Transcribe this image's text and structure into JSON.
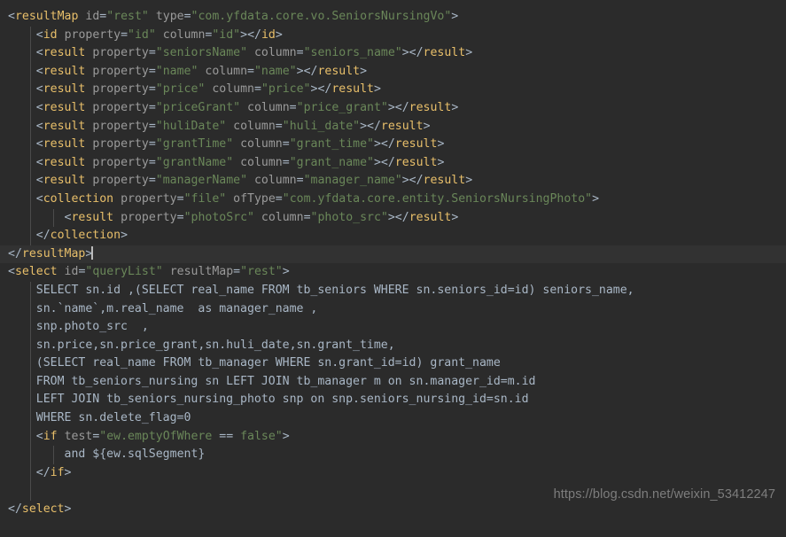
{
  "editor": {
    "theme": "darcula",
    "background": "#2b2b2b",
    "current_line_background": "#323232",
    "default_text_color": "#a9b7c6",
    "colors": {
      "tag": "#e8bf6a",
      "attribute": "#9a9a9a",
      "string_value": "#6a8759",
      "punctuation": "#a9b7c6",
      "plain_sql": "#a9b7c6",
      "indent_guide": "#4b4b4b",
      "caret": "#bbbbbb",
      "watermark": "#7d7d7d"
    },
    "caret_line_index": 13
  },
  "watermark": {
    "text": "https://blog.csdn.net/weixin_53412247"
  },
  "code": {
    "language": "xml",
    "lines": [
      {
        "indent": 0,
        "guides": [],
        "current": false,
        "tokens": [
          {
            "t": "punct",
            "s": "<"
          },
          {
            "t": "tag",
            "s": "resultMap"
          },
          {
            "t": "punct",
            "s": " "
          },
          {
            "t": "attr",
            "s": "id"
          },
          {
            "t": "eq",
            "s": "="
          },
          {
            "t": "val",
            "s": "\"rest\""
          },
          {
            "t": "punct",
            "s": " "
          },
          {
            "t": "attr",
            "s": "type"
          },
          {
            "t": "eq",
            "s": "="
          },
          {
            "t": "val",
            "s": "\"com.yfdata.core.vo.SeniorsNursingVo\""
          },
          {
            "t": "punct",
            "s": ">"
          }
        ]
      },
      {
        "indent": 1,
        "guides": [
          1
        ],
        "current": false,
        "tokens": [
          {
            "t": "punct",
            "s": "<"
          },
          {
            "t": "tag",
            "s": "id"
          },
          {
            "t": "punct",
            "s": " "
          },
          {
            "t": "attr",
            "s": "property"
          },
          {
            "t": "eq",
            "s": "="
          },
          {
            "t": "val",
            "s": "\"id\""
          },
          {
            "t": "punct",
            "s": " "
          },
          {
            "t": "attr",
            "s": "column"
          },
          {
            "t": "eq",
            "s": "="
          },
          {
            "t": "val",
            "s": "\"id\""
          },
          {
            "t": "punct",
            "s": "></"
          },
          {
            "t": "tag",
            "s": "id"
          },
          {
            "t": "punct",
            "s": ">"
          }
        ]
      },
      {
        "indent": 1,
        "guides": [
          1
        ],
        "current": false,
        "tokens": [
          {
            "t": "punct",
            "s": "<"
          },
          {
            "t": "tag",
            "s": "result"
          },
          {
            "t": "punct",
            "s": " "
          },
          {
            "t": "attr",
            "s": "property"
          },
          {
            "t": "eq",
            "s": "="
          },
          {
            "t": "val",
            "s": "\"seniorsName\""
          },
          {
            "t": "punct",
            "s": " "
          },
          {
            "t": "attr",
            "s": "column"
          },
          {
            "t": "eq",
            "s": "="
          },
          {
            "t": "val",
            "s": "\"seniors_name\""
          },
          {
            "t": "punct",
            "s": "></"
          },
          {
            "t": "tag",
            "s": "result"
          },
          {
            "t": "punct",
            "s": ">"
          }
        ]
      },
      {
        "indent": 1,
        "guides": [
          1
        ],
        "current": false,
        "tokens": [
          {
            "t": "punct",
            "s": "<"
          },
          {
            "t": "tag",
            "s": "result"
          },
          {
            "t": "punct",
            "s": " "
          },
          {
            "t": "attr",
            "s": "property"
          },
          {
            "t": "eq",
            "s": "="
          },
          {
            "t": "val",
            "s": "\"name\""
          },
          {
            "t": "punct",
            "s": " "
          },
          {
            "t": "attr",
            "s": "column"
          },
          {
            "t": "eq",
            "s": "="
          },
          {
            "t": "val",
            "s": "\"name\""
          },
          {
            "t": "punct",
            "s": "></"
          },
          {
            "t": "tag",
            "s": "result"
          },
          {
            "t": "punct",
            "s": ">"
          }
        ]
      },
      {
        "indent": 1,
        "guides": [
          1
        ],
        "current": false,
        "tokens": [
          {
            "t": "punct",
            "s": "<"
          },
          {
            "t": "tag",
            "s": "result"
          },
          {
            "t": "punct",
            "s": " "
          },
          {
            "t": "attr",
            "s": "property"
          },
          {
            "t": "eq",
            "s": "="
          },
          {
            "t": "val",
            "s": "\"price\""
          },
          {
            "t": "punct",
            "s": " "
          },
          {
            "t": "attr",
            "s": "column"
          },
          {
            "t": "eq",
            "s": "="
          },
          {
            "t": "val",
            "s": "\"price\""
          },
          {
            "t": "punct",
            "s": "></"
          },
          {
            "t": "tag",
            "s": "result"
          },
          {
            "t": "punct",
            "s": ">"
          }
        ]
      },
      {
        "indent": 1,
        "guides": [
          1
        ],
        "current": false,
        "tokens": [
          {
            "t": "punct",
            "s": "<"
          },
          {
            "t": "tag",
            "s": "result"
          },
          {
            "t": "punct",
            "s": " "
          },
          {
            "t": "attr",
            "s": "property"
          },
          {
            "t": "eq",
            "s": "="
          },
          {
            "t": "val",
            "s": "\"priceGrant\""
          },
          {
            "t": "punct",
            "s": " "
          },
          {
            "t": "attr",
            "s": "column"
          },
          {
            "t": "eq",
            "s": "="
          },
          {
            "t": "val",
            "s": "\"price_grant\""
          },
          {
            "t": "punct",
            "s": "></"
          },
          {
            "t": "tag",
            "s": "result"
          },
          {
            "t": "punct",
            "s": ">"
          }
        ]
      },
      {
        "indent": 1,
        "guides": [
          1
        ],
        "current": false,
        "tokens": [
          {
            "t": "punct",
            "s": "<"
          },
          {
            "t": "tag",
            "s": "result"
          },
          {
            "t": "punct",
            "s": " "
          },
          {
            "t": "attr",
            "s": "property"
          },
          {
            "t": "eq",
            "s": "="
          },
          {
            "t": "val",
            "s": "\"huliDate\""
          },
          {
            "t": "punct",
            "s": " "
          },
          {
            "t": "attr",
            "s": "column"
          },
          {
            "t": "eq",
            "s": "="
          },
          {
            "t": "val",
            "s": "\"huli_date\""
          },
          {
            "t": "punct",
            "s": "></"
          },
          {
            "t": "tag",
            "s": "result"
          },
          {
            "t": "punct",
            "s": ">"
          }
        ]
      },
      {
        "indent": 1,
        "guides": [
          1
        ],
        "current": false,
        "tokens": [
          {
            "t": "punct",
            "s": "<"
          },
          {
            "t": "tag",
            "s": "result"
          },
          {
            "t": "punct",
            "s": " "
          },
          {
            "t": "attr",
            "s": "property"
          },
          {
            "t": "eq",
            "s": "="
          },
          {
            "t": "val",
            "s": "\"grantTime\""
          },
          {
            "t": "punct",
            "s": " "
          },
          {
            "t": "attr",
            "s": "column"
          },
          {
            "t": "eq",
            "s": "="
          },
          {
            "t": "val",
            "s": "\"grant_time\""
          },
          {
            "t": "punct",
            "s": "></"
          },
          {
            "t": "tag",
            "s": "result"
          },
          {
            "t": "punct",
            "s": ">"
          }
        ]
      },
      {
        "indent": 1,
        "guides": [
          1
        ],
        "current": false,
        "tokens": [
          {
            "t": "punct",
            "s": "<"
          },
          {
            "t": "tag",
            "s": "result"
          },
          {
            "t": "punct",
            "s": " "
          },
          {
            "t": "attr",
            "s": "property"
          },
          {
            "t": "eq",
            "s": "="
          },
          {
            "t": "val",
            "s": "\"grantName\""
          },
          {
            "t": "punct",
            "s": " "
          },
          {
            "t": "attr",
            "s": "column"
          },
          {
            "t": "eq",
            "s": "="
          },
          {
            "t": "val",
            "s": "\"grant_name\""
          },
          {
            "t": "punct",
            "s": "></"
          },
          {
            "t": "tag",
            "s": "result"
          },
          {
            "t": "punct",
            "s": ">"
          }
        ]
      },
      {
        "indent": 1,
        "guides": [
          1
        ],
        "current": false,
        "tokens": [
          {
            "t": "punct",
            "s": "<"
          },
          {
            "t": "tag",
            "s": "result"
          },
          {
            "t": "punct",
            "s": " "
          },
          {
            "t": "attr",
            "s": "property"
          },
          {
            "t": "eq",
            "s": "="
          },
          {
            "t": "val",
            "s": "\"managerName\""
          },
          {
            "t": "punct",
            "s": " "
          },
          {
            "t": "attr",
            "s": "column"
          },
          {
            "t": "eq",
            "s": "="
          },
          {
            "t": "val",
            "s": "\"manager_name\""
          },
          {
            "t": "punct",
            "s": "></"
          },
          {
            "t": "tag",
            "s": "result"
          },
          {
            "t": "punct",
            "s": ">"
          }
        ]
      },
      {
        "indent": 1,
        "guides": [
          1
        ],
        "current": false,
        "tokens": [
          {
            "t": "punct",
            "s": "<"
          },
          {
            "t": "tag",
            "s": "collection"
          },
          {
            "t": "punct",
            "s": " "
          },
          {
            "t": "attr",
            "s": "property"
          },
          {
            "t": "eq",
            "s": "="
          },
          {
            "t": "val",
            "s": "\"file\""
          },
          {
            "t": "punct",
            "s": " "
          },
          {
            "t": "attr",
            "s": "ofType"
          },
          {
            "t": "eq",
            "s": "="
          },
          {
            "t": "val",
            "s": "\"com.yfdata.core.entity.SeniorsNursingPhoto\""
          },
          {
            "t": "punct",
            "s": ">"
          }
        ]
      },
      {
        "indent": 2,
        "guides": [
          1,
          2
        ],
        "current": false,
        "tokens": [
          {
            "t": "punct",
            "s": "<"
          },
          {
            "t": "tag",
            "s": "result"
          },
          {
            "t": "punct",
            "s": " "
          },
          {
            "t": "attr",
            "s": "property"
          },
          {
            "t": "eq",
            "s": "="
          },
          {
            "t": "val",
            "s": "\"photoSrc\""
          },
          {
            "t": "punct",
            "s": " "
          },
          {
            "t": "attr",
            "s": "column"
          },
          {
            "t": "eq",
            "s": "="
          },
          {
            "t": "val",
            "s": "\"photo_src\""
          },
          {
            "t": "punct",
            "s": "></"
          },
          {
            "t": "tag",
            "s": "result"
          },
          {
            "t": "punct",
            "s": ">"
          }
        ]
      },
      {
        "indent": 1,
        "guides": [
          1
        ],
        "current": false,
        "tokens": [
          {
            "t": "punct",
            "s": "</"
          },
          {
            "t": "tag",
            "s": "collection"
          },
          {
            "t": "punct",
            "s": ">"
          }
        ]
      },
      {
        "indent": 0,
        "guides": [],
        "current": true,
        "caret": true,
        "tokens": [
          {
            "t": "punct",
            "s": "</"
          },
          {
            "t": "tag",
            "s": "resultMap"
          },
          {
            "t": "punct",
            "s": ">"
          }
        ]
      },
      {
        "indent": 0,
        "guides": [],
        "current": false,
        "tokens": [
          {
            "t": "punct",
            "s": "<"
          },
          {
            "t": "tag",
            "s": "select"
          },
          {
            "t": "punct",
            "s": " "
          },
          {
            "t": "attr",
            "s": "id"
          },
          {
            "t": "eq",
            "s": "="
          },
          {
            "t": "val",
            "s": "\"queryList\""
          },
          {
            "t": "punct",
            "s": " "
          },
          {
            "t": "attr",
            "s": "resultMap"
          },
          {
            "t": "eq",
            "s": "="
          },
          {
            "t": "val",
            "s": "\"rest\""
          },
          {
            "t": "punct",
            "s": ">"
          }
        ]
      },
      {
        "indent": 1,
        "guides": [
          1
        ],
        "current": false,
        "tokens": [
          {
            "t": "sql",
            "s": "SELECT sn.id ,(SELECT real_name FROM tb_seniors WHERE sn.seniors_id=id) seniors_name,"
          }
        ]
      },
      {
        "indent": 1,
        "guides": [
          1
        ],
        "current": false,
        "tokens": [
          {
            "t": "sql",
            "s": "sn.`name`,m.real_name  as manager_name ,"
          }
        ]
      },
      {
        "indent": 1,
        "guides": [
          1
        ],
        "current": false,
        "tokens": [
          {
            "t": "sql",
            "s": "snp.photo_src  ,"
          }
        ]
      },
      {
        "indent": 1,
        "guides": [
          1
        ],
        "current": false,
        "tokens": [
          {
            "t": "sql",
            "s": "sn.price,sn.price_grant,sn.huli_date,sn.grant_time,"
          }
        ]
      },
      {
        "indent": 1,
        "guides": [
          1
        ],
        "current": false,
        "tokens": [
          {
            "t": "sql",
            "s": "(SELECT real_name FROM tb_manager WHERE sn.grant_id=id) grant_name"
          }
        ]
      },
      {
        "indent": 1,
        "guides": [
          1
        ],
        "current": false,
        "tokens": [
          {
            "t": "sql",
            "s": "FROM tb_seniors_nursing sn LEFT JOIN tb_manager m on sn.manager_id=m.id"
          }
        ]
      },
      {
        "indent": 1,
        "guides": [
          1
        ],
        "current": false,
        "tokens": [
          {
            "t": "sql",
            "s": "LEFT JOIN tb_seniors_nursing_photo snp on snp.seniors_nursing_id=sn.id"
          }
        ]
      },
      {
        "indent": 1,
        "guides": [
          1
        ],
        "current": false,
        "tokens": [
          {
            "t": "sql",
            "s": "WHERE sn.delete_flag=0"
          }
        ]
      },
      {
        "indent": 1,
        "guides": [
          1
        ],
        "current": false,
        "tokens": [
          {
            "t": "punct",
            "s": "<"
          },
          {
            "t": "tag",
            "s": "if"
          },
          {
            "t": "punct",
            "s": " "
          },
          {
            "t": "attr",
            "s": "test"
          },
          {
            "t": "eq",
            "s": "="
          },
          {
            "t": "val",
            "s": "\"ew.emptyOfWhere "
          },
          {
            "t": "op",
            "s": "=="
          },
          {
            "t": "val",
            "s": " false\""
          },
          {
            "t": "punct",
            "s": ">"
          }
        ]
      },
      {
        "indent": 2,
        "guides": [
          1,
          2
        ],
        "current": false,
        "tokens": [
          {
            "t": "sql",
            "s": "and ${ew.sqlSegment}"
          }
        ]
      },
      {
        "indent": 1,
        "guides": [
          1
        ],
        "current": false,
        "tokens": [
          {
            "t": "punct",
            "s": "</"
          },
          {
            "t": "tag",
            "s": "if"
          },
          {
            "t": "punct",
            "s": ">"
          }
        ]
      },
      {
        "indent": 0,
        "guides": [
          1
        ],
        "current": false,
        "tokens": []
      },
      {
        "indent": 0,
        "guides": [],
        "current": false,
        "tokens": [
          {
            "t": "punct",
            "s": "</"
          },
          {
            "t": "tag",
            "s": "select"
          },
          {
            "t": "punct",
            "s": ">"
          }
        ]
      }
    ]
  }
}
